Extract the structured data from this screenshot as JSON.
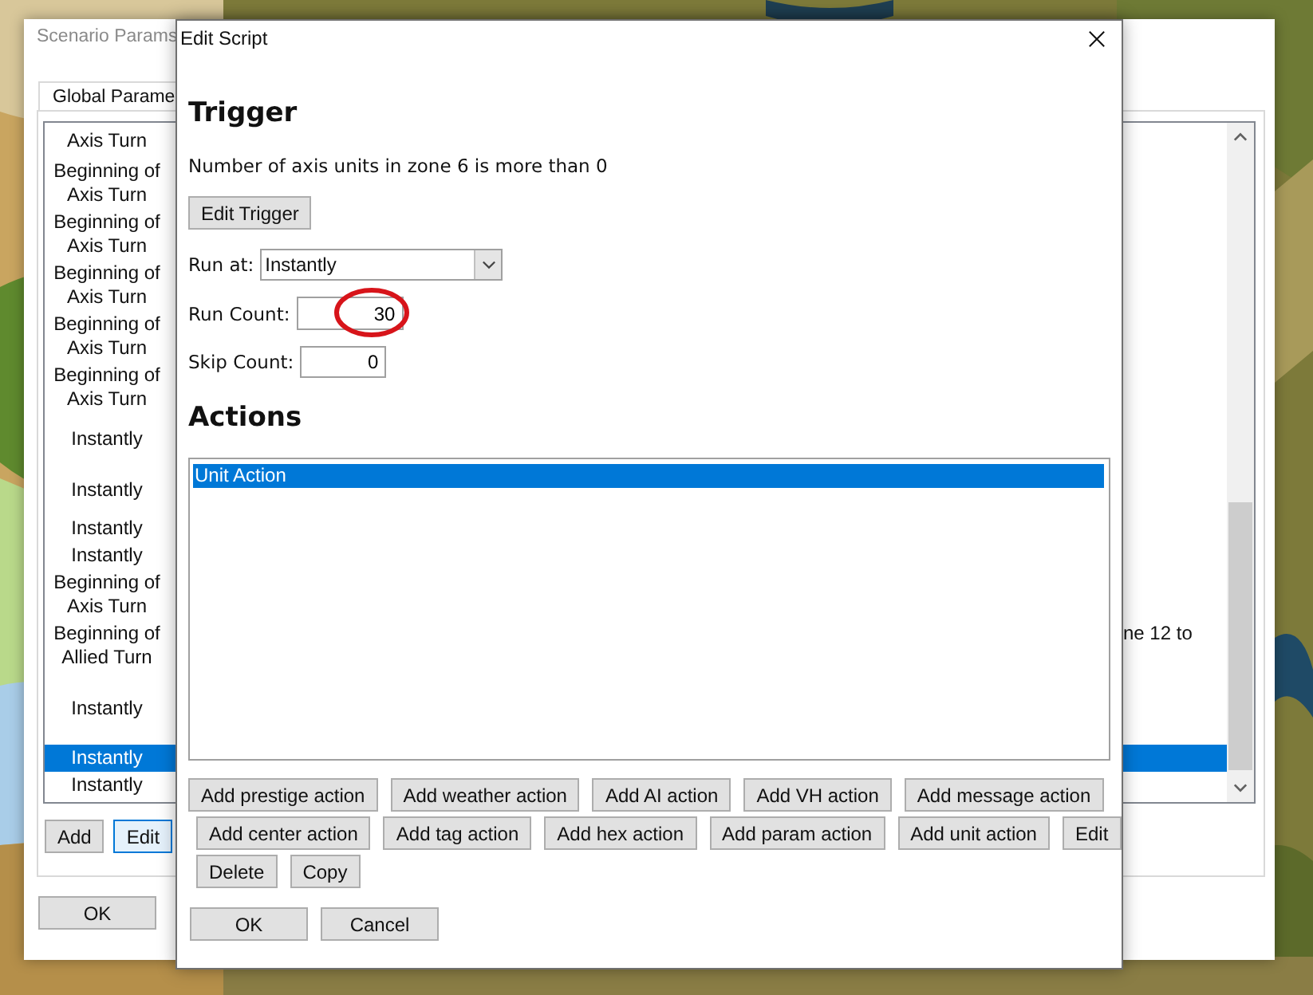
{
  "back_window": {
    "title": "Scenario Params",
    "tab": {
      "label": "Global Parame",
      "selected": true
    },
    "rows": [
      {
        "kind": "top",
        "lines": [
          "Axis Turn"
        ],
        "selected": false
      },
      {
        "kind": "double",
        "lines": [
          "Beginning of",
          "Axis Turn"
        ],
        "selected": false
      },
      {
        "kind": "double",
        "lines": [
          "Beginning of",
          "Axis Turn"
        ],
        "selected": false
      },
      {
        "kind": "double",
        "lines": [
          "Beginning of",
          "Axis Turn"
        ],
        "selected": false
      },
      {
        "kind": "double",
        "lines": [
          "Beginning of",
          "Axis Turn"
        ],
        "selected": false
      },
      {
        "kind": "double",
        "lines": [
          "Beginning of",
          "Axis Turn"
        ],
        "selected": false
      },
      {
        "kind": "single",
        "lines": [
          "Instantly"
        ],
        "selected": false
      },
      {
        "kind": "single",
        "lines": [
          "Instantly"
        ],
        "selected": false
      },
      {
        "kind": "short",
        "lines": [
          "Instantly"
        ],
        "selected": false
      },
      {
        "kind": "short",
        "lines": [
          "Instantly"
        ],
        "selected": false
      },
      {
        "kind": "double",
        "lines": [
          "Beginning of",
          "Axis Turn"
        ],
        "selected": false
      },
      {
        "kind": "double",
        "lines": [
          "Beginning of",
          "Allied Turn"
        ],
        "column_3": "ne 12 to",
        "selected": false
      },
      {
        "kind": "tall",
        "lines": [
          "Instantly"
        ],
        "selected": false
      },
      {
        "kind": "short",
        "lines": [
          "Instantly"
        ],
        "selected": true
      },
      {
        "kind": "short",
        "lines": [
          "Instantly"
        ],
        "selected": false
      }
    ],
    "buttons": [
      {
        "label": "Add",
        "focused": false
      },
      {
        "label": "Edit",
        "focused": true
      }
    ],
    "ok_button": "OK"
  },
  "dialog": {
    "title": "Edit Script",
    "trigger_heading": "Trigger",
    "trigger_text": "Number of axis units in zone 6 is more than 0",
    "edit_trigger_button": "Edit Trigger",
    "run_at": {
      "label": "Run at:",
      "value": "Instantly"
    },
    "run_count": {
      "label": "Run Count:",
      "value": "30"
    },
    "skip_count": {
      "label": "Skip Count:",
      "value": "0"
    },
    "actions_heading": "Actions",
    "actions": [
      {
        "label": "Unit Action",
        "selected": true
      }
    ],
    "action_button_rows": [
      {
        "buttons": [
          "Add prestige action",
          "Add weather action",
          "Add AI action",
          "Add VH action",
          "Add message action"
        ]
      },
      {
        "buttons": [
          "Add center action",
          "Add tag action",
          "Add hex action",
          "Add param action",
          "Add unit action",
          "Edit"
        ]
      },
      {
        "buttons": [
          "Delete",
          "Copy"
        ]
      }
    ],
    "ok_button": "OK",
    "cancel_button": "Cancel"
  }
}
